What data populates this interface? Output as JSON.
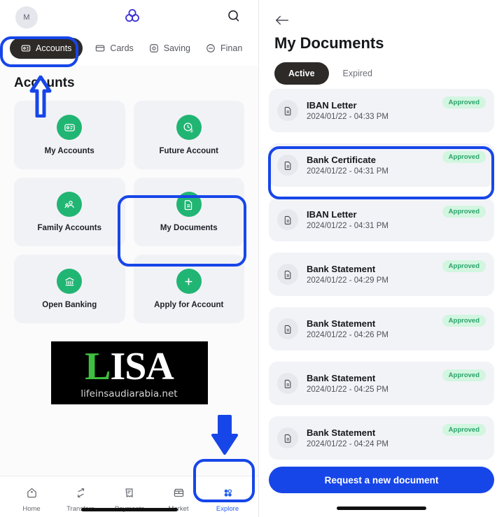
{
  "left_screen": {
    "header": {
      "avatar_initial": "M",
      "logo_icon": "trefoil-logo-icon",
      "search_icon": "search-icon"
    },
    "tabs": [
      {
        "label": "Accounts",
        "icon": "id-card-icon",
        "active": true
      },
      {
        "label": "Cards",
        "icon": "credit-card-icon",
        "active": false
      },
      {
        "label": "Saving",
        "icon": "piggy-save-icon",
        "active": false
      },
      {
        "label": "Finan",
        "icon": "finance-icon",
        "active": false
      }
    ],
    "section_title": "Accounts",
    "cards": [
      {
        "label": "My Accounts",
        "icon": "id-card-icon"
      },
      {
        "label": "Future Account",
        "icon": "clock-dollar-icon"
      },
      {
        "label": "Family Accounts",
        "icon": "family-person-icon"
      },
      {
        "label": "My Documents",
        "icon": "document-icon"
      },
      {
        "label": "Open Banking",
        "icon": "bank-building-icon"
      },
      {
        "label": "Apply for Account",
        "icon": "plus-icon"
      }
    ],
    "watermark": {
      "first_letter": "L",
      "rest_letters": "ISA",
      "subtitle": "lifeinsaudiarabia.net"
    },
    "bottom_nav": [
      {
        "label": "Home",
        "icon": "home-icon",
        "active": false
      },
      {
        "label": "Transfers",
        "icon": "transfers-arrows-icon",
        "active": false
      },
      {
        "label": "Payments",
        "icon": "receipt-icon",
        "active": false
      },
      {
        "label": "Market",
        "icon": "market-stall-icon",
        "active": false
      },
      {
        "label": "Explore",
        "icon": "grid-dots-icon",
        "active": true
      }
    ]
  },
  "right_screen": {
    "back_icon": "back-arrow-icon",
    "title": "My Documents",
    "segments": [
      {
        "label": "Active",
        "active": true
      },
      {
        "label": "Expired",
        "active": false
      }
    ],
    "documents": [
      {
        "name": "IBAN Letter",
        "date": "2024/01/22 - 04:33 PM",
        "status": "Approved",
        "highlighted": false
      },
      {
        "name": "Bank Certificate",
        "date": "2024/01/22 - 04:31 PM",
        "status": "Approved",
        "highlighted": true
      },
      {
        "name": "IBAN Letter",
        "date": "2024/01/22 - 04:31 PM",
        "status": "Approved",
        "highlighted": false
      },
      {
        "name": "Bank Statement",
        "date": "2024/01/22 - 04:29 PM",
        "status": "Approved",
        "highlighted": false
      },
      {
        "name": "Bank Statement",
        "date": "2024/01/22 - 04:26 PM",
        "status": "Approved",
        "highlighted": false
      },
      {
        "name": "Bank Statement",
        "date": "2024/01/22 - 04:25 PM",
        "status": "Approved",
        "highlighted": false
      },
      {
        "name": "Bank Statement",
        "date": "2024/01/22 - 04:24 PM",
        "status": "Approved",
        "highlighted": false
      }
    ],
    "cta_label": "Request a new document"
  },
  "annotations": {
    "highlight_color": "#1746e8",
    "boxes": [
      "accounts-tab",
      "my-documents-card",
      "explore-nav-item",
      "bank-certificate-row"
    ],
    "arrows": [
      "up-arrow-to-accounts-tab",
      "down-arrow-to-explore"
    ]
  },
  "colors": {
    "accent_blue": "#1746e8",
    "green": "#21b573",
    "badge_bg": "#d2f6e0",
    "badge_text": "#2aa36a",
    "dark_pill": "#2d2a28"
  }
}
